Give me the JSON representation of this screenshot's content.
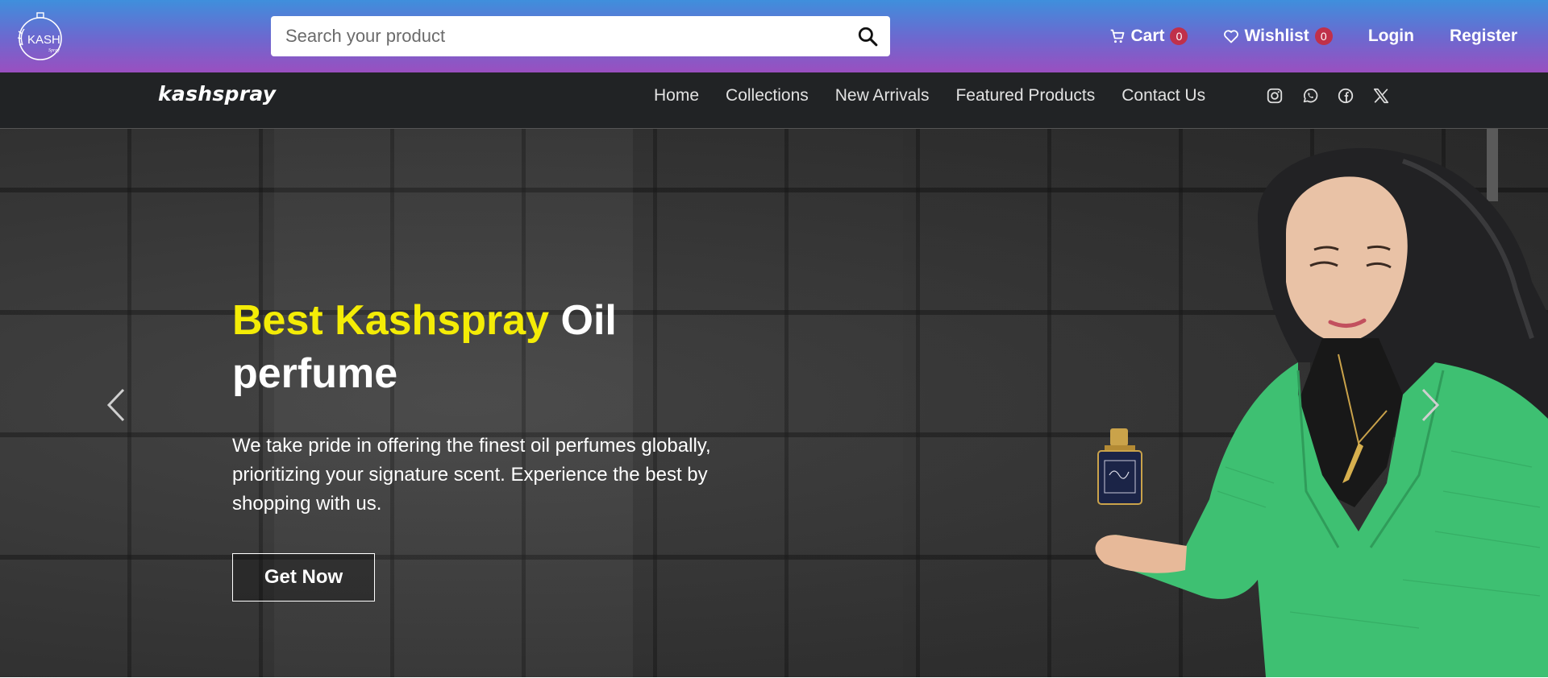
{
  "header": {
    "search": {
      "placeholder": "Search your product"
    },
    "cart": {
      "label": "Cart",
      "count": "0"
    },
    "wishlist": {
      "label": "Wishlist",
      "count": "0"
    },
    "login_label": "Login",
    "register_label": "Register",
    "logo_text": "KASH",
    "logo_subtext": "Spray"
  },
  "nav": {
    "brand": "kashspray",
    "links": [
      "Home",
      "Collections",
      "New Arrivals",
      "Featured Products",
      "Contact Us"
    ],
    "socials": [
      "instagram-icon",
      "whatsapp-icon",
      "facebook-icon",
      "x-twitter-icon"
    ]
  },
  "hero": {
    "headline_highlight": "Best Kashspray",
    "headline_rest": " Oil perfume",
    "description": "We take pride in offering the finest oil perfumes globally, prioritizing your signature scent. Experience the best by shopping with us.",
    "cta_label": "Get Now",
    "prev_icon": "chevron-left-icon",
    "next_icon": "chevron-right-icon"
  },
  "colors": {
    "header_gradient_top": "#3f8fdc",
    "header_gradient_bottom": "#9a4fc0",
    "nav_bg": "#212325",
    "badge": "#c0304a",
    "headline_highlight": "#f4ec06",
    "sweater": "#3ec072"
  }
}
